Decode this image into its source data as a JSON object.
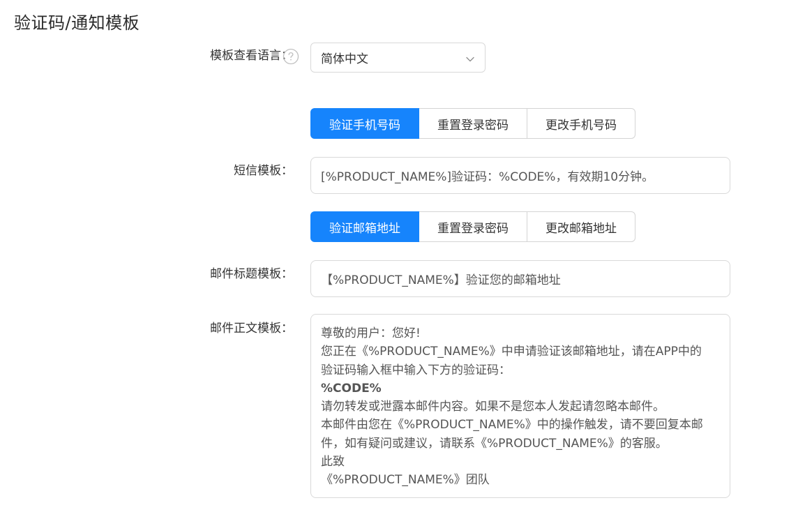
{
  "page": {
    "title": "验证码/通知模板"
  },
  "language": {
    "label": "模板查看语言：",
    "selected": "简体中文",
    "help_icon": "question-circle-icon",
    "dropdown_icon": "chevron-down-icon"
  },
  "sms": {
    "tabs": [
      {
        "label": "验证手机号码",
        "active": true
      },
      {
        "label": "重置登录密码",
        "active": false
      },
      {
        "label": "更改手机号码",
        "active": false
      }
    ],
    "label": "短信模板：",
    "value": "[%PRODUCT_NAME%]验证码：%CODE%，有效期10分钟。"
  },
  "email": {
    "tabs": [
      {
        "label": "验证邮箱地址",
        "active": true
      },
      {
        "label": "重置登录密码",
        "active": false
      },
      {
        "label": "更改邮箱地址",
        "active": false
      }
    ],
    "subject_label": "邮件标题模板：",
    "subject_value": "【%PRODUCT_NAME%】验证您的邮箱地址",
    "body_label": "邮件正文模板：",
    "body_lines": [
      "尊敬的用户：您好!",
      "您正在《%PRODUCT_NAME%》中申请验证该邮箱地址，请在APP中的",
      "验证码输入框中输入下方的验证码：",
      "%CODE%",
      "请勿转发或泄露本邮件内容。如果不是您本人发起请忽略本邮件。",
      "本邮件由您在《%PRODUCT_NAME%》中的操作触发，请不要回复本邮",
      "件，如有疑问或建议，请联系《%PRODUCT_NAME%》的客服。",
      "此致",
      "《%PRODUCT_NAME%》团队"
    ]
  },
  "colors": {
    "accent": "#1684fc",
    "border": "#d9d9d9",
    "text": "#333333"
  }
}
